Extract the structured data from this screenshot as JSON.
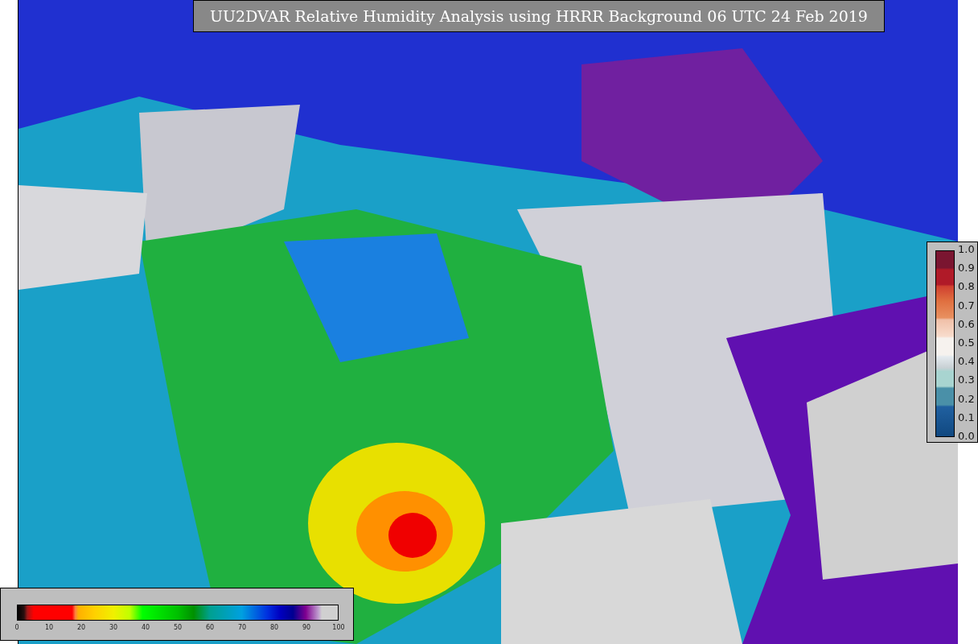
{
  "title": "UU2DVAR Relative Humidity Analysis using HRRR Background 06 UTC 24 Feb 2019",
  "bottom_colorbar": {
    "ticks": [
      "0",
      "10",
      "20",
      "30",
      "40",
      "50",
      "60",
      "70",
      "80",
      "90",
      "100"
    ]
  },
  "right_colorbar": {
    "ticks": [
      "1.0",
      "0.9",
      "0.8",
      "0.7",
      "0.6",
      "0.5",
      "0.4",
      "0.3",
      "0.2",
      "0.1",
      "0.0"
    ]
  }
}
